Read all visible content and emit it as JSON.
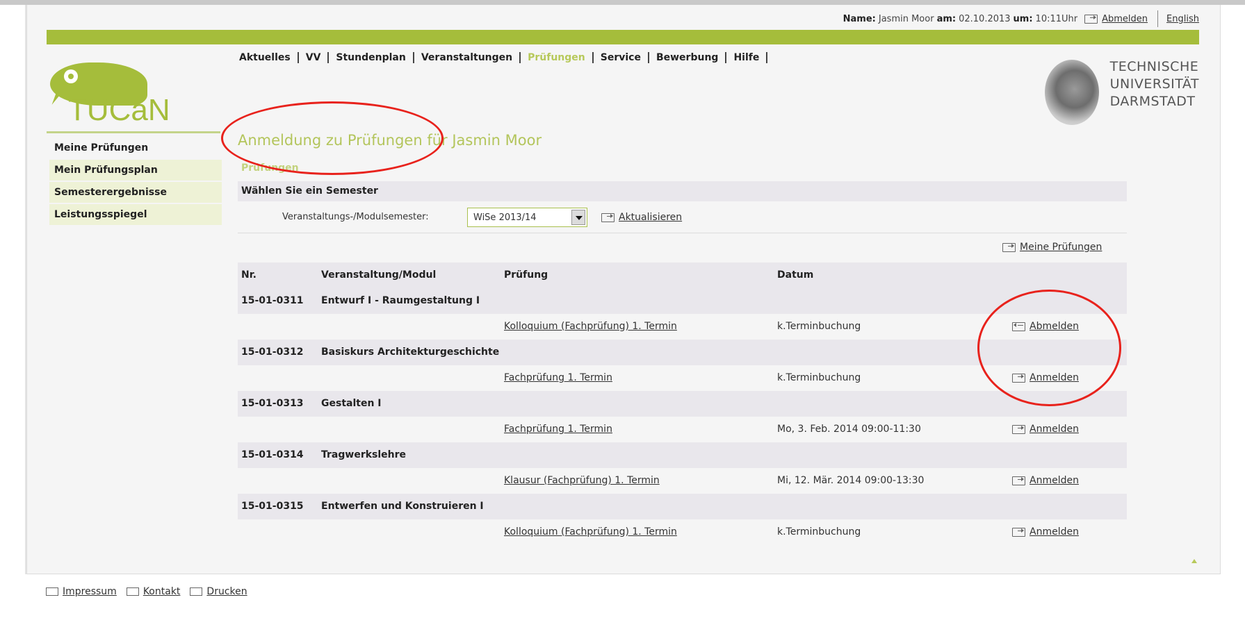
{
  "user_line": {
    "name_label": "Name:",
    "name_value": "Jasmin Moor",
    "date_label": "am:",
    "date_value": "02.10.2013",
    "time_label": "um:",
    "time_value": "10:11Uhr",
    "logout": "Abmelden",
    "language": "English"
  },
  "logo": {
    "text": "TUCaN"
  },
  "university": {
    "line1": "TECHNISCHE",
    "line2": "UNIVERSITÄT",
    "line3": "DARMSTADT"
  },
  "nav": [
    {
      "label": "Aktuelles"
    },
    {
      "label": "VV"
    },
    {
      "label": "Stundenplan"
    },
    {
      "label": "Veranstaltungen"
    },
    {
      "label": "Prüfungen"
    },
    {
      "label": "Service"
    },
    {
      "label": "Bewerbung"
    },
    {
      "label": "Hilfe"
    }
  ],
  "sidebar": [
    {
      "label": "Meine Prüfungen"
    },
    {
      "label": "Mein Prüfungsplan"
    },
    {
      "label": "Semesterergebnisse"
    },
    {
      "label": "Leistungsspiegel"
    }
  ],
  "main": {
    "title": "Anmeldung zu Prüfungen für Jasmin Moor",
    "section": "Prüfungen",
    "semester_heading": "Wählen Sie ein Semester",
    "semester_label": "Veranstaltungs-/Modulsemester:",
    "semester_value": "WiSe 2013/14",
    "refresh": "Aktualisieren",
    "my_exams": "Meine Prüfungen"
  },
  "table": {
    "headers": {
      "nr": "Nr.",
      "module": "Veranstaltung/Modul",
      "exam": "Prüfung",
      "date": "Datum"
    },
    "modules": [
      {
        "nr": "15-01-0311",
        "name": "Entwurf I - Raumgestaltung I",
        "exam": "Kolloquium (Fachprüfung) 1. Termin",
        "date": "k.Terminbuchung",
        "action": "Abmelden"
      },
      {
        "nr": "15-01-0312",
        "name": "Basiskurs Architekturgeschichte",
        "exam": "Fachprüfung 1. Termin",
        "date": "k.Terminbuchung",
        "action": "Anmelden"
      },
      {
        "nr": "15-01-0313",
        "name": "Gestalten I",
        "exam": "Fachprüfung 1. Termin",
        "date": "Mo, 3. Feb. 2014 09:00-11:30",
        "action": "Anmelden"
      },
      {
        "nr": "15-01-0314",
        "name": "Tragwerkslehre",
        "exam": "Klausur (Fachprüfung) 1. Termin",
        "date": "Mi, 12. Mär. 2014 09:00-13:30",
        "action": "Anmelden"
      },
      {
        "nr": "15-01-0315",
        "name": "Entwerfen und Konstruieren I",
        "exam": "Kolloquium (Fachprüfung) 1. Termin",
        "date": "k.Terminbuchung",
        "action": "Anmelden"
      }
    ]
  },
  "footer": [
    {
      "label": "Impressum"
    },
    {
      "label": "Kontakt"
    },
    {
      "label": "Drucken"
    }
  ],
  "colors": {
    "accent": "#a5bd3b",
    "highlight": "#e8221c",
    "row_shade": "#e9e7ec"
  }
}
